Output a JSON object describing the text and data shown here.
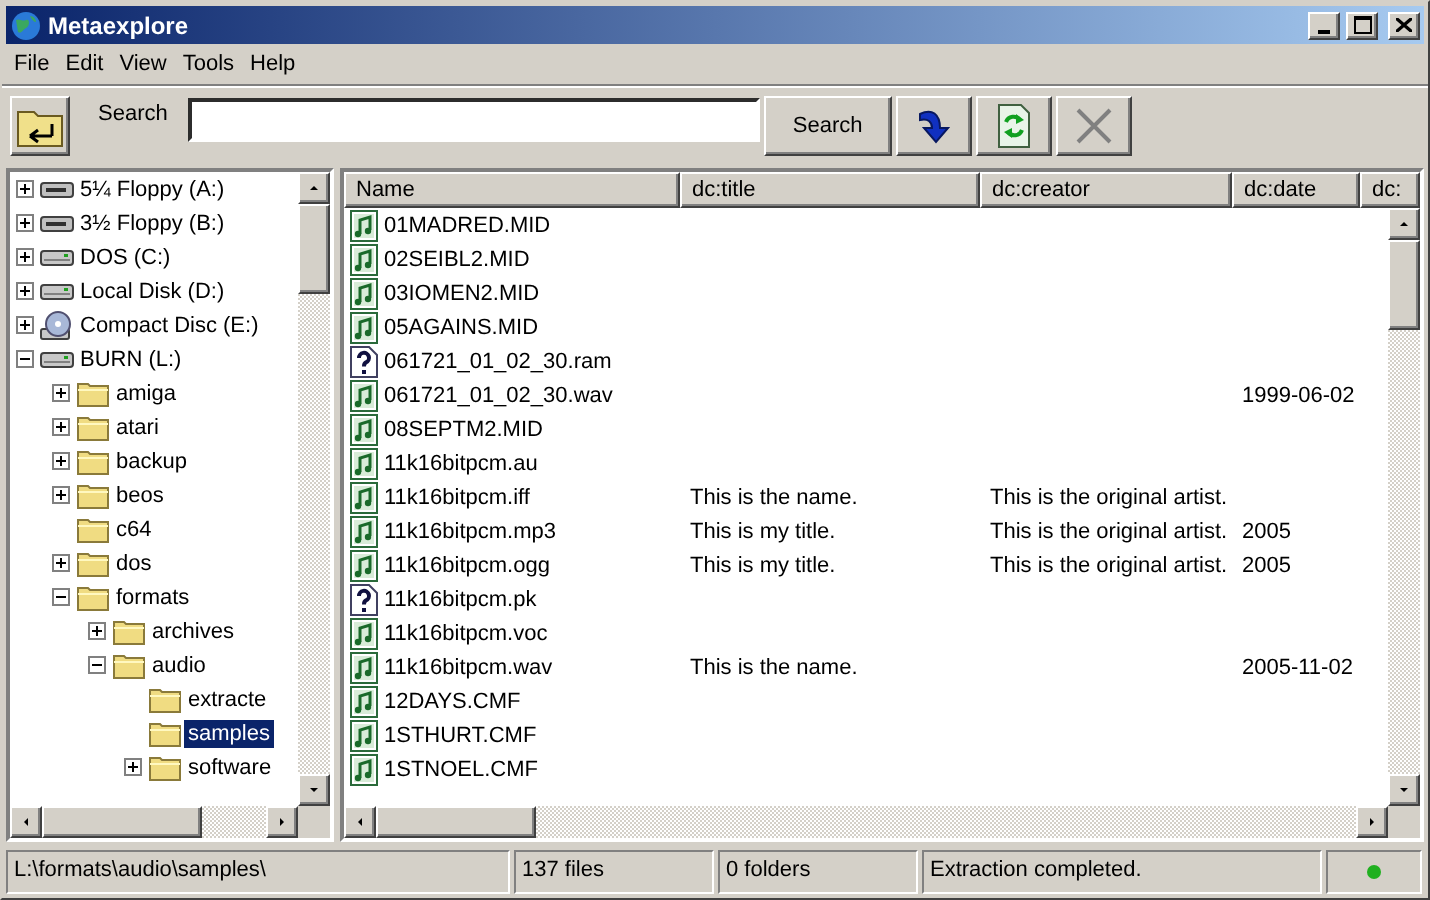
{
  "window": {
    "title": "Metaexplore"
  },
  "menu": [
    "File",
    "Edit",
    "View",
    "Tools",
    "Help"
  ],
  "toolbar": {
    "search_label": "Search",
    "search_button": "Search"
  },
  "tree": [
    {
      "label": "5¼ Floppy (A:)",
      "kind": "floppy",
      "expanded": false,
      "selected": false
    },
    {
      "label": "3½ Floppy (B:)",
      "kind": "floppy",
      "expanded": false,
      "selected": false
    },
    {
      "label": "DOS (C:)",
      "kind": "drive",
      "expanded": false,
      "selected": false
    },
    {
      "label": "Local Disk (D:)",
      "kind": "drive",
      "expanded": false,
      "selected": false
    },
    {
      "label": "Compact Disc (E:)",
      "kind": "cdrom",
      "expanded": false,
      "selected": false
    },
    {
      "label": "BURN (L:)",
      "kind": "drive",
      "expanded": true,
      "selected": false,
      "children": [
        {
          "label": "amiga",
          "kind": "folder",
          "expanded": false,
          "selected": false
        },
        {
          "label": "atari",
          "kind": "folder",
          "expanded": false,
          "selected": false
        },
        {
          "label": "backup",
          "kind": "folder",
          "expanded": false,
          "selected": false
        },
        {
          "label": "beos",
          "kind": "folder",
          "expanded": false,
          "selected": false
        },
        {
          "label": "c64",
          "kind": "folder",
          "selected": false
        },
        {
          "label": "dos",
          "kind": "folder",
          "expanded": false,
          "selected": false
        },
        {
          "label": "formats",
          "kind": "folder",
          "expanded": true,
          "selected": false,
          "children": [
            {
              "label": "archives",
              "kind": "folder",
              "expanded": false,
              "selected": false
            },
            {
              "label": "audio",
              "kind": "folder",
              "expanded": true,
              "selected": false,
              "children": [
                {
                  "label": "extracte",
                  "kind": "folder",
                  "selected": false
                },
                {
                  "label": "samples",
                  "kind": "folder",
                  "selected": true
                },
                {
                  "label": "software",
                  "kind": "folder",
                  "expanded": false,
                  "selected": false
                }
              ]
            }
          ]
        }
      ]
    }
  ],
  "table": {
    "columns": [
      "Name",
      "dc:title",
      "dc:creator",
      "dc:date",
      "dc:"
    ],
    "rows": [
      {
        "kind": "audio",
        "name": "01MADRED.MID"
      },
      {
        "kind": "audio",
        "name": "02SEIBL2.MID"
      },
      {
        "kind": "audio",
        "name": "03IOMEN2.MID"
      },
      {
        "kind": "audio",
        "name": "05AGAINS.MID"
      },
      {
        "kind": "unknown",
        "name": "061721_01_02_30.ram"
      },
      {
        "kind": "audio",
        "name": "061721_01_02_30.wav",
        "date": "1999-06-02"
      },
      {
        "kind": "audio",
        "name": "08SEPTM2.MID"
      },
      {
        "kind": "audio",
        "name": "11k16bitpcm.au"
      },
      {
        "kind": "audio",
        "name": "11k16bitpcm.iff",
        "title": "This is the name.",
        "creator": "This is the original artist."
      },
      {
        "kind": "audio",
        "name": "11k16bitpcm.mp3",
        "title": "This is my title.",
        "creator": "This is the original artist.",
        "date": "2005"
      },
      {
        "kind": "audio",
        "name": "11k16bitpcm.ogg",
        "title": "This is my title.",
        "creator": "This is the original artist.",
        "date": "2005"
      },
      {
        "kind": "unknown",
        "name": "11k16bitpcm.pk"
      },
      {
        "kind": "audio",
        "name": "11k16bitpcm.voc"
      },
      {
        "kind": "audio",
        "name": "11k16bitpcm.wav",
        "title": "This is the name.",
        "date": "2005-11-02"
      },
      {
        "kind": "audio",
        "name": "12DAYS.CMF"
      },
      {
        "kind": "audio",
        "name": "1STHURT.CMF"
      },
      {
        "kind": "audio",
        "name": "1STNOEL.CMF"
      }
    ]
  },
  "status_bar": {
    "path": "L:\\formats\\audio\\samples\\",
    "files": "137 files",
    "folders": "0 folders",
    "message": "Extraction completed."
  }
}
